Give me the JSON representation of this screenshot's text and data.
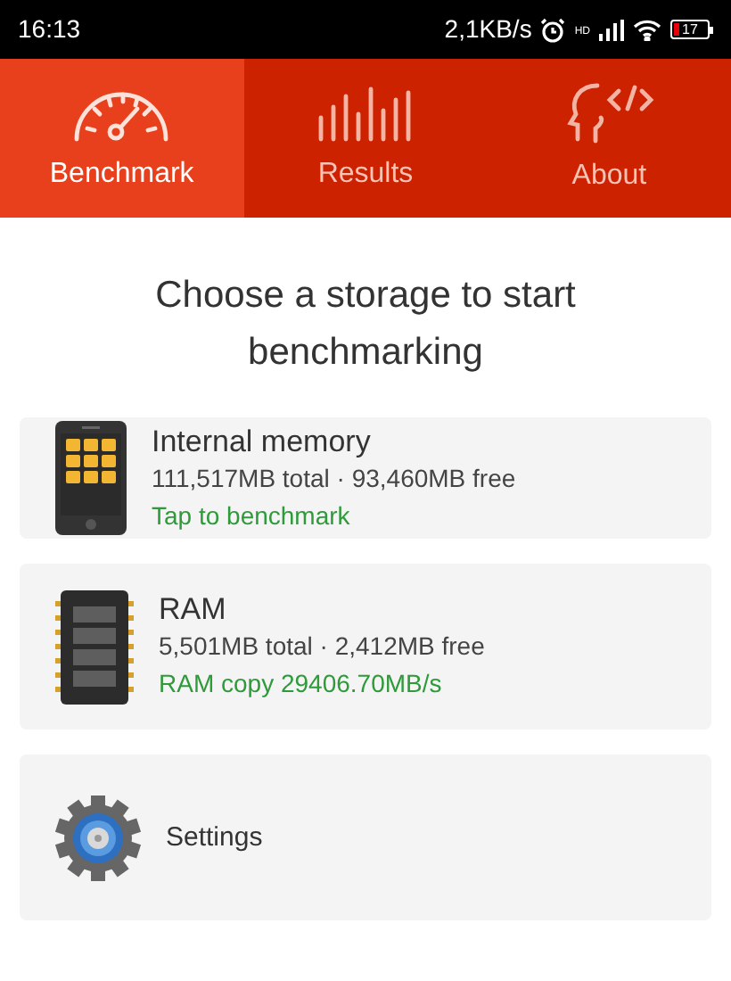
{
  "status_bar": {
    "time": "16:13",
    "speed": "2,1KB/s",
    "network": "HD",
    "battery": "17"
  },
  "tabs": [
    {
      "label": "Benchmark",
      "kind": "gauge",
      "selected": true
    },
    {
      "label": "Results",
      "kind": "bars",
      "selected": false
    },
    {
      "label": "About",
      "kind": "head",
      "selected": false
    }
  ],
  "heading": "Choose a storage to start benchmarking",
  "cards": [
    {
      "kind": "storage",
      "title": "Internal memory",
      "detail": "111,517MB total · 93,460MB free",
      "status": "Tap to benchmark"
    },
    {
      "kind": "ram",
      "title": "RAM",
      "detail": "5,501MB total · 2,412MB free",
      "status": "RAM copy 29406.70MB/s"
    },
    {
      "kind": "settings",
      "title": "Settings"
    }
  ]
}
